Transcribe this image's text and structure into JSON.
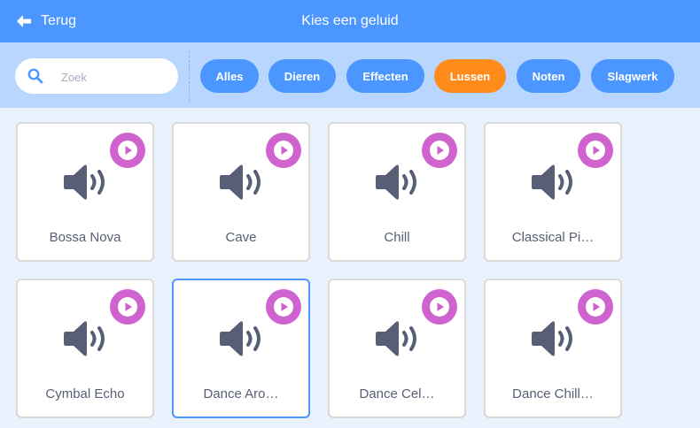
{
  "header": {
    "back_label": "Terug",
    "title": "Kies een geluid",
    "color": "#4c97ff"
  },
  "filterbar": {
    "search_placeholder": "Zoek",
    "tags": [
      {
        "label": "Alles",
        "active": false
      },
      {
        "label": "Dieren",
        "active": false
      },
      {
        "label": "Effecten",
        "active": false
      },
      {
        "label": "Lussen",
        "active": true
      },
      {
        "label": "Noten",
        "active": false
      },
      {
        "label": "Slagwerk",
        "active": false
      }
    ],
    "tag_color": "#4c97ff",
    "active_tag_color": "#ff8c1a"
  },
  "sounds": [
    {
      "name": "Bossa Nova",
      "selected": false
    },
    {
      "name": "Cave",
      "selected": false
    },
    {
      "name": "Chill",
      "selected": false
    },
    {
      "name": "Classical Pi…",
      "selected": false
    },
    {
      "name": "Cymbal Echo",
      "selected": false
    },
    {
      "name": "Dance Aro…",
      "selected": true
    },
    {
      "name": "Dance Cel…",
      "selected": false
    },
    {
      "name": "Dance Chill…",
      "selected": false
    }
  ],
  "icons": {
    "back": "arrow-left-icon",
    "search": "search-icon",
    "play": "play-icon",
    "sound": "speaker-icon"
  },
  "colors": {
    "play_button": "#cf63cf",
    "speaker": "#575e75",
    "selected_border": "#4c97ff"
  }
}
